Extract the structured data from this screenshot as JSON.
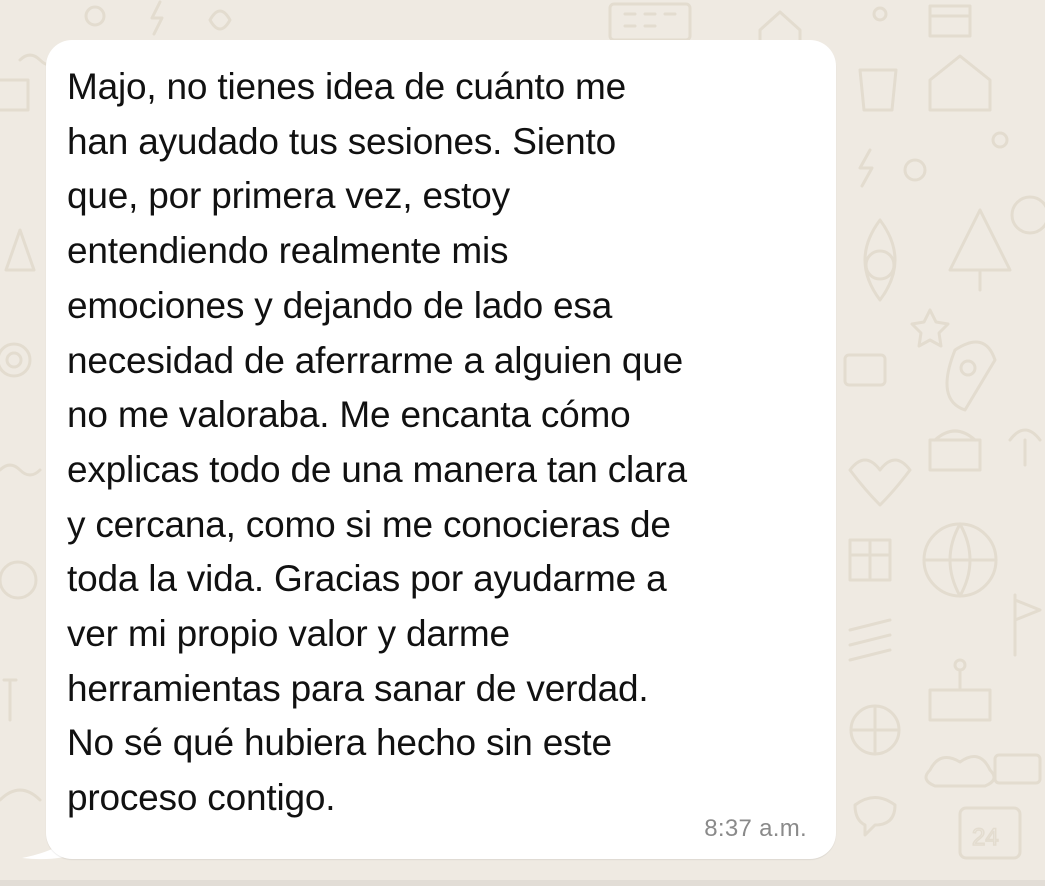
{
  "chat": {
    "message": {
      "text": "Majo, no tienes idea de cuánto me\nhan ayudado tus sesiones. Siento\nque, por primera vez, estoy\nentendiendo realmente mis\nemociones y dejando de lado esa\nnecesidad de aferrarme a alguien que\nno me valoraba. Me encanta cómo\nexplicas todo de una manera tan clara\ny cercana, como si me conocieras de\ntoda la vida. Gracias por ayudarme a\nver mi propio valor y darme\nherramientas para sanar de verdad.\nNo sé qué hubiera hecho sin este\nproceso contigo.",
      "timestamp": "8:37 a.m.",
      "direction": "incoming"
    },
    "wallpaper": {
      "style": "doodle-pattern",
      "background_color": "#efeae2",
      "doodle_color": "#e3dccf",
      "doodle_number": "24"
    },
    "bubble_color": "#ffffff",
    "text_color": "#111111",
    "timestamp_color": "#8a8a8a"
  }
}
